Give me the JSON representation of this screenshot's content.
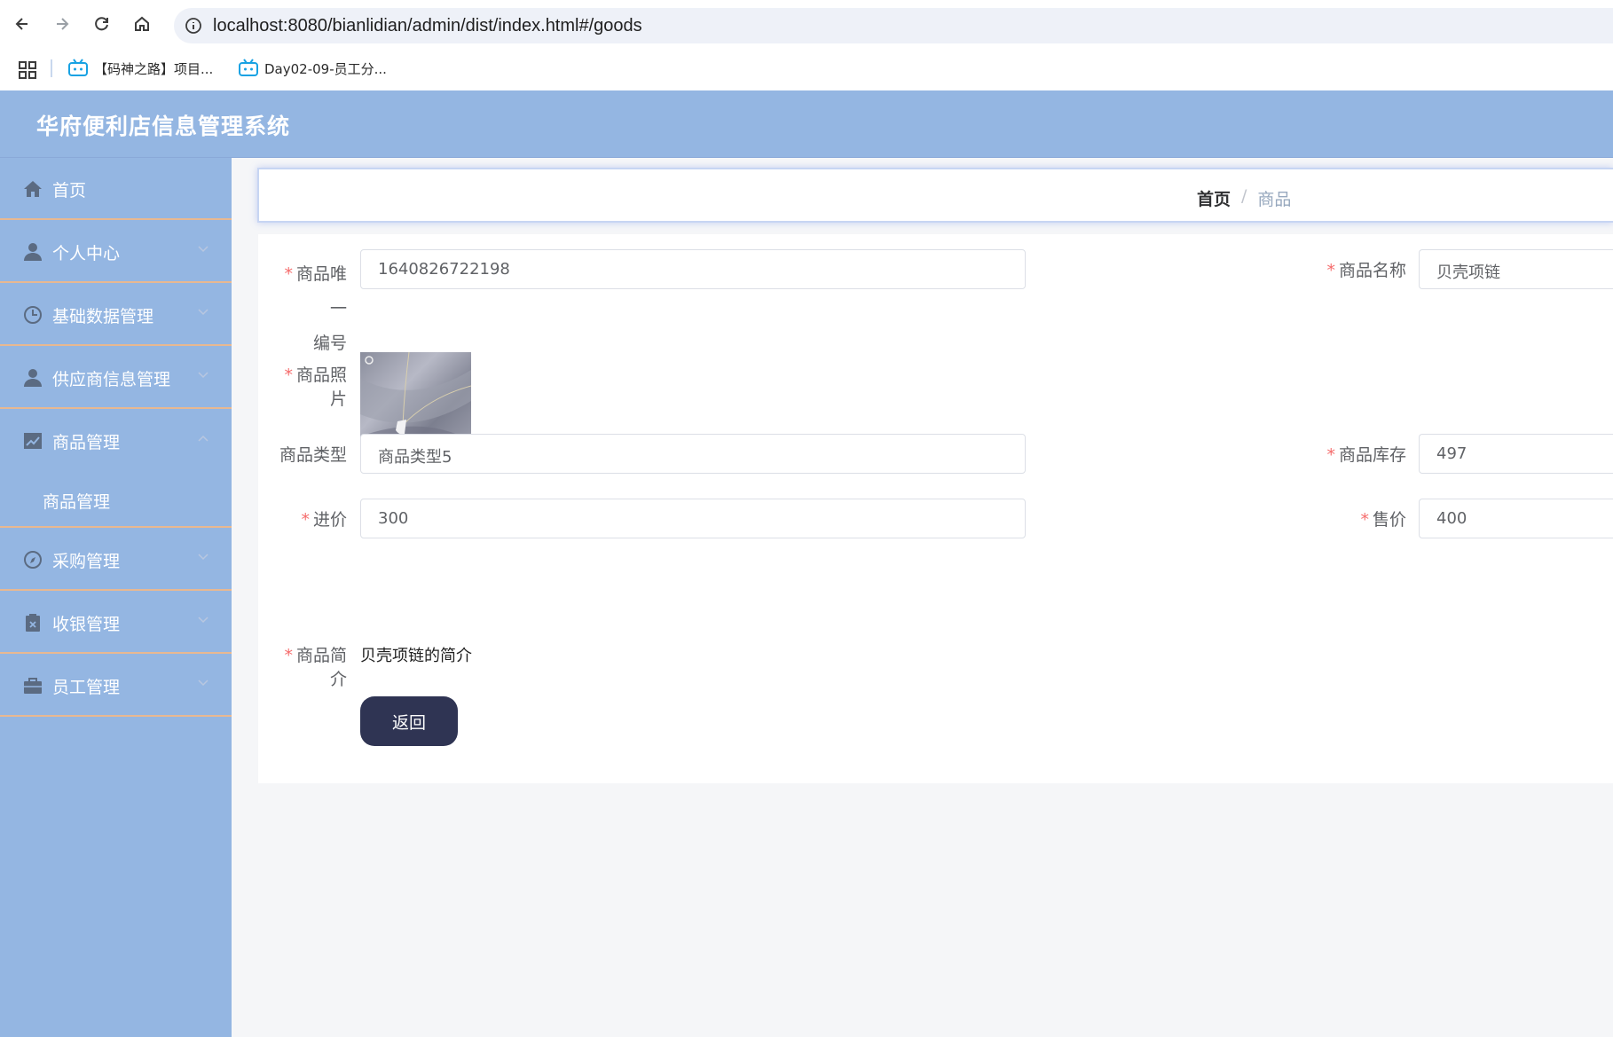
{
  "browser": {
    "url": "localhost:8080/bianlidian/admin/dist/index.html#/goods",
    "bookmarks": [
      {
        "label": "【码神之路】项目..."
      },
      {
        "label": "Day02-09-员工分..."
      }
    ]
  },
  "app": {
    "title": "华府便利店信息管理系统"
  },
  "sidebar": {
    "items": [
      {
        "label": "首页",
        "icon": "home-icon"
      },
      {
        "label": "个人中心",
        "icon": "user-icon"
      },
      {
        "label": "基础数据管理",
        "icon": "clock-icon"
      },
      {
        "label": "供应商信息管理",
        "icon": "user-icon"
      },
      {
        "label": "商品管理",
        "icon": "chart-icon"
      },
      {
        "label": "采购管理",
        "icon": "compass-icon"
      },
      {
        "label": "收银管理",
        "icon": "clipboard-icon"
      },
      {
        "label": "员工管理",
        "icon": "briefcase-icon"
      }
    ],
    "sub_item": {
      "label": "商品管理"
    }
  },
  "breadcrumb": {
    "home": "首页",
    "separator": "/",
    "current": "商品"
  },
  "form": {
    "required_mark": "*",
    "unique_id": {
      "label_line1": "商品唯一",
      "label_line2": "编号",
      "value": "1640826722198"
    },
    "name": {
      "label": "商品名称",
      "value": "贝壳项链"
    },
    "photo": {
      "label": "商品照片"
    },
    "type": {
      "label": "商品类型",
      "value": "商品类型5"
    },
    "stock": {
      "label": "商品库存",
      "value": "497"
    },
    "purchase_price": {
      "label": "进价",
      "value": "300"
    },
    "sale_price": {
      "label": "售价",
      "value": "400"
    },
    "description": {
      "label": "商品简介",
      "value": "贝壳项链的简介"
    },
    "back_button": "返回"
  },
  "colors": {
    "header": "#94b6e2",
    "sidebar": "#94b6e2",
    "menu_divider": "#e8b891",
    "button": "#2f3453",
    "required": "#f56c6c"
  }
}
